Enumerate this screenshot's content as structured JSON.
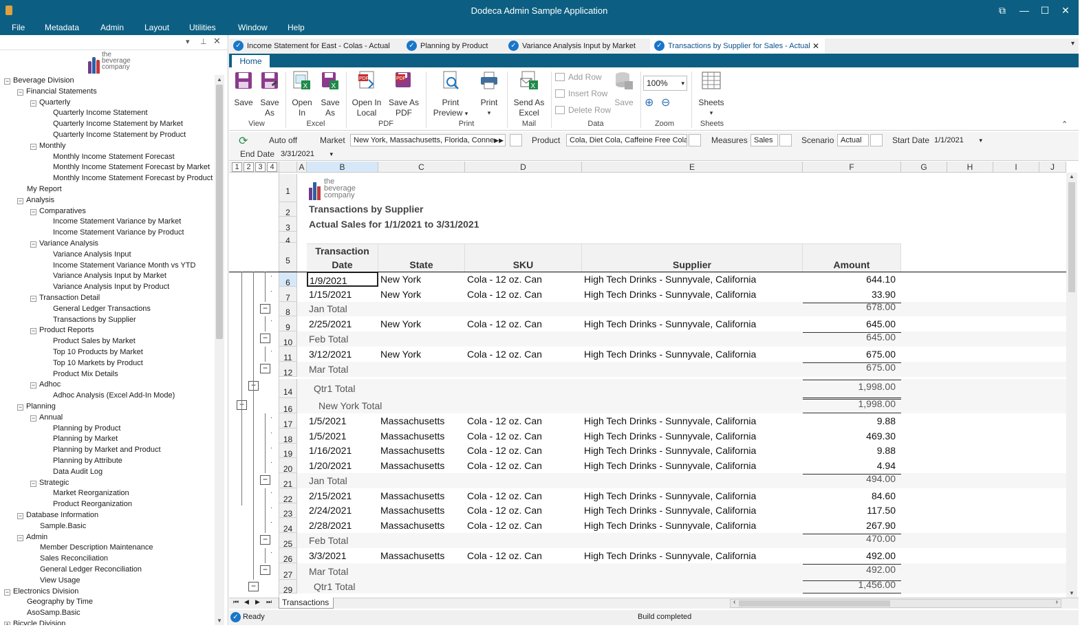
{
  "window": {
    "title": "Dodeca Admin Sample Application"
  },
  "menu": [
    "File",
    "Metadata",
    "Admin",
    "Layout",
    "Utilities",
    "Window",
    "Help"
  ],
  "logo": {
    "line1": "the",
    "line2": "beverage",
    "line3": "company"
  },
  "tree": [
    {
      "label": "Beverage Division",
      "level": 0,
      "toggle": "−"
    },
    {
      "label": "Financial Statements",
      "level": 1,
      "toggle": "−"
    },
    {
      "label": "Quarterly",
      "level": 2,
      "toggle": "−"
    },
    {
      "label": "Quarterly Income Statement",
      "level": 3
    },
    {
      "label": "Quarterly Income Statement by Market",
      "level": 3
    },
    {
      "label": "Quarterly Income Statement by Product",
      "level": 3
    },
    {
      "label": "Monthly",
      "level": 2,
      "toggle": "−"
    },
    {
      "label": "Monthly Income Statement Forecast",
      "level": 3
    },
    {
      "label": "Monthly Income Statement Forecast by Market",
      "level": 3
    },
    {
      "label": "Monthly Income Statement Forecast by Product",
      "level": 3
    },
    {
      "label": "My Report",
      "level": 1
    },
    {
      "label": "Analysis",
      "level": 1,
      "toggle": "−"
    },
    {
      "label": "Comparatives",
      "level": 2,
      "toggle": "−"
    },
    {
      "label": "Income Statement Variance by Market",
      "level": 3
    },
    {
      "label": "Income Statement Variance by Product",
      "level": 3
    },
    {
      "label": "Variance Analysis",
      "level": 2,
      "toggle": "−"
    },
    {
      "label": "Variance Analysis Input",
      "level": 3
    },
    {
      "label": "Income Statement Variance Month vs YTD",
      "level": 3
    },
    {
      "label": "Variance Analysis Input by Market",
      "level": 3
    },
    {
      "label": "Variance Analysis Input by Product",
      "level": 3
    },
    {
      "label": "Transaction Detail",
      "level": 2,
      "toggle": "−"
    },
    {
      "label": "General Ledger Transactions",
      "level": 3
    },
    {
      "label": "Transactions by Supplier",
      "level": 3
    },
    {
      "label": "Product Reports",
      "level": 2,
      "toggle": "−"
    },
    {
      "label": "Product Sales by Market",
      "level": 3
    },
    {
      "label": "Top 10 Products by Market",
      "level": 3
    },
    {
      "label": "Top 10 Markets by Product",
      "level": 3
    },
    {
      "label": "Product Mix Details",
      "level": 3
    },
    {
      "label": "Adhoc",
      "level": 2,
      "toggle": "−"
    },
    {
      "label": "Adhoc Analysis (Excel Add-In Mode)",
      "level": 3
    },
    {
      "label": "Planning",
      "level": 1,
      "toggle": "−"
    },
    {
      "label": "Annual",
      "level": 2,
      "toggle": "−"
    },
    {
      "label": "Planning by Product",
      "level": 3
    },
    {
      "label": "Planning by Market",
      "level": 3
    },
    {
      "label": "Planning by Market and Product",
      "level": 3
    },
    {
      "label": "Planning by Attribute",
      "level": 3
    },
    {
      "label": "Data Audit Log",
      "level": 3
    },
    {
      "label": "Strategic",
      "level": 2,
      "toggle": "−"
    },
    {
      "label": "Market Reorganization",
      "level": 3
    },
    {
      "label": "Product Reorganization",
      "level": 3
    },
    {
      "label": "Database Information",
      "level": 1,
      "toggle": "−"
    },
    {
      "label": "Sample.Basic",
      "level": 2
    },
    {
      "label": "Admin",
      "level": 1,
      "toggle": "−"
    },
    {
      "label": "Member Description Maintenance",
      "level": 2
    },
    {
      "label": "Sales Reconciliation",
      "level": 2
    },
    {
      "label": "General Ledger Reconciliation",
      "level": 2
    },
    {
      "label": "View Usage",
      "level": 2
    },
    {
      "label": "Electronics Division",
      "level": 0,
      "toggle": "−"
    },
    {
      "label": "Geography by Time",
      "level": 1
    },
    {
      "label": "AsoSamp.Basic",
      "level": 1
    },
    {
      "label": "Bicycle Division",
      "level": 0,
      "toggle": "+"
    }
  ],
  "tabs": [
    {
      "label": "Income Statement for East - Colas - Actual"
    },
    {
      "label": "Planning by Product"
    },
    {
      "label": "Variance Analysis Input by Market"
    },
    {
      "label": "Transactions by Supplier for Sales - Actual",
      "active": true
    }
  ],
  "ribbon": {
    "home_tab": "Home",
    "save": "Save",
    "save_as_1": "Save",
    "save_as_2": "As",
    "open_in_1": "Open",
    "open_in_2": "In",
    "excel_save_as_1": "Save",
    "excel_save_as_2": "As",
    "open_local_1": "Open In",
    "open_local_2": "Local",
    "save_pdf_1": "Save As",
    "save_pdf_2": "PDF",
    "print_preview_1": "Print",
    "print_preview_2": "Preview",
    "print": "Print",
    "send_excel_1": "Send As",
    "send_excel_2": "Excel",
    "add_row": "Add Row",
    "insert_row": "Insert Row",
    "delete_row": "Delete Row",
    "data_save": "Save",
    "zoom": "100%",
    "sheets": "Sheets",
    "groups": {
      "view": "View",
      "excel": "Excel",
      "pdf": "PDF",
      "print": "Print",
      "mail": "Mail",
      "data": "Data",
      "zoom": "Zoom",
      "sheets": "Sheets"
    }
  },
  "filters": {
    "auto_off": "Auto off",
    "market_label": "Market",
    "market_value": "New York, Massachusetts, Florida, Connec",
    "product_label": "Product",
    "product_value": "Cola, Diet Cola, Caffeine Free Cola",
    "measures_label": "Measures",
    "measures_value": "Sales",
    "scenario_label": "Scenario",
    "scenario_value": "Actual",
    "start_label": "Start Date",
    "start_value": "1/1/2021",
    "end_label": "End Date",
    "end_value": "3/31/2021"
  },
  "grid": {
    "outline_levels": [
      "1",
      "2",
      "3",
      "4"
    ],
    "columns": [
      "A",
      "B",
      "C",
      "D",
      "E",
      "F",
      "G",
      "H",
      "I",
      "J"
    ],
    "report_title": "Transactions by Supplier",
    "report_subtitle": "Actual Sales for 1/1/2021 to 3/31/2021",
    "headers": {
      "date_1": "Transaction",
      "date_2": "Date",
      "state": "State",
      "sku": "SKU",
      "supplier": "Supplier",
      "amount": "Amount"
    },
    "rows": [
      {
        "n": "1",
        "kind": "blank"
      },
      {
        "n": "2",
        "kind": "blank"
      },
      {
        "n": "3",
        "kind": "blank"
      },
      {
        "n": "4",
        "kind": "blank"
      },
      {
        "n": "5",
        "kind": "header"
      },
      {
        "n": "6",
        "kind": "data",
        "date": "1/9/2021",
        "state": "New York",
        "sku": "Cola - 12 oz. Can",
        "supplier": "High Tech Drinks - Sunnyvale, California",
        "amount": "644.10"
      },
      {
        "n": "7",
        "kind": "data",
        "date": "1/15/2021",
        "state": "New York",
        "sku": "Cola - 12 oz. Can",
        "supplier": "High Tech Drinks - Sunnyvale, California",
        "amount": "33.90"
      },
      {
        "n": "8",
        "kind": "total",
        "label": "Jan Total",
        "amount": "678.00"
      },
      {
        "n": "9",
        "kind": "data",
        "date": "2/25/2021",
        "state": "New York",
        "sku": "Cola - 12 oz. Can",
        "supplier": "High Tech Drinks - Sunnyvale, California",
        "amount": "645.00"
      },
      {
        "n": "10",
        "kind": "total",
        "label": "Feb Total",
        "amount": "645.00"
      },
      {
        "n": "11",
        "kind": "data",
        "date": "3/12/2021",
        "state": "New York",
        "sku": "Cola - 12 oz. Can",
        "supplier": "High Tech Drinks - Sunnyvale, California",
        "amount": "675.00"
      },
      {
        "n": "12",
        "kind": "total",
        "label": "Mar Total",
        "amount": "675.00"
      },
      {
        "n": "14",
        "kind": "qtotal",
        "label": "Qtr1 Total",
        "amount": "1,998.00"
      },
      {
        "n": "16",
        "kind": "stotal",
        "label": "New York Total",
        "amount": "1,998.00"
      },
      {
        "n": "17",
        "kind": "data",
        "date": "1/5/2021",
        "state": "Massachusetts",
        "sku": "Cola - 12 oz. Can",
        "supplier": "High Tech Drinks - Sunnyvale, California",
        "amount": "9.88"
      },
      {
        "n": "18",
        "kind": "data",
        "date": "1/5/2021",
        "state": "Massachusetts",
        "sku": "Cola - 12 oz. Can",
        "supplier": "High Tech Drinks - Sunnyvale, California",
        "amount": "469.30"
      },
      {
        "n": "19",
        "kind": "data",
        "date": "1/16/2021",
        "state": "Massachusetts",
        "sku": "Cola - 12 oz. Can",
        "supplier": "High Tech Drinks - Sunnyvale, California",
        "amount": "9.88"
      },
      {
        "n": "20",
        "kind": "data",
        "date": "1/20/2021",
        "state": "Massachusetts",
        "sku": "Cola - 12 oz. Can",
        "supplier": "High Tech Drinks - Sunnyvale, California",
        "amount": "4.94"
      },
      {
        "n": "21",
        "kind": "total",
        "label": "Jan Total",
        "amount": "494.00"
      },
      {
        "n": "22",
        "kind": "data",
        "date": "2/15/2021",
        "state": "Massachusetts",
        "sku": "Cola - 12 oz. Can",
        "supplier": "High Tech Drinks - Sunnyvale, California",
        "amount": "84.60"
      },
      {
        "n": "23",
        "kind": "data",
        "date": "2/24/2021",
        "state": "Massachusetts",
        "sku": "Cola - 12 oz. Can",
        "supplier": "High Tech Drinks - Sunnyvale, California",
        "amount": "117.50"
      },
      {
        "n": "24",
        "kind": "data",
        "date": "2/28/2021",
        "state": "Massachusetts",
        "sku": "Cola - 12 oz. Can",
        "supplier": "High Tech Drinks - Sunnyvale, California",
        "amount": "267.90"
      },
      {
        "n": "25",
        "kind": "total",
        "label": "Feb Total",
        "amount": "470.00"
      },
      {
        "n": "26",
        "kind": "data",
        "date": "3/3/2021",
        "state": "Massachusetts",
        "sku": "Cola - 12 oz. Can",
        "supplier": "High Tech Drinks - Sunnyvale, California",
        "amount": "492.00"
      },
      {
        "n": "27",
        "kind": "total",
        "label": "Mar Total",
        "amount": "492.00"
      },
      {
        "n": "29",
        "kind": "qtotal",
        "label": "Qtr1 Total",
        "amount": "1,456.00"
      }
    ]
  },
  "sheet_tab": "Transactions",
  "status": {
    "ready": "Ready",
    "build": "Build completed"
  },
  "colors": {
    "titlebar": "#0c5f82",
    "accent": "#1976c8"
  }
}
